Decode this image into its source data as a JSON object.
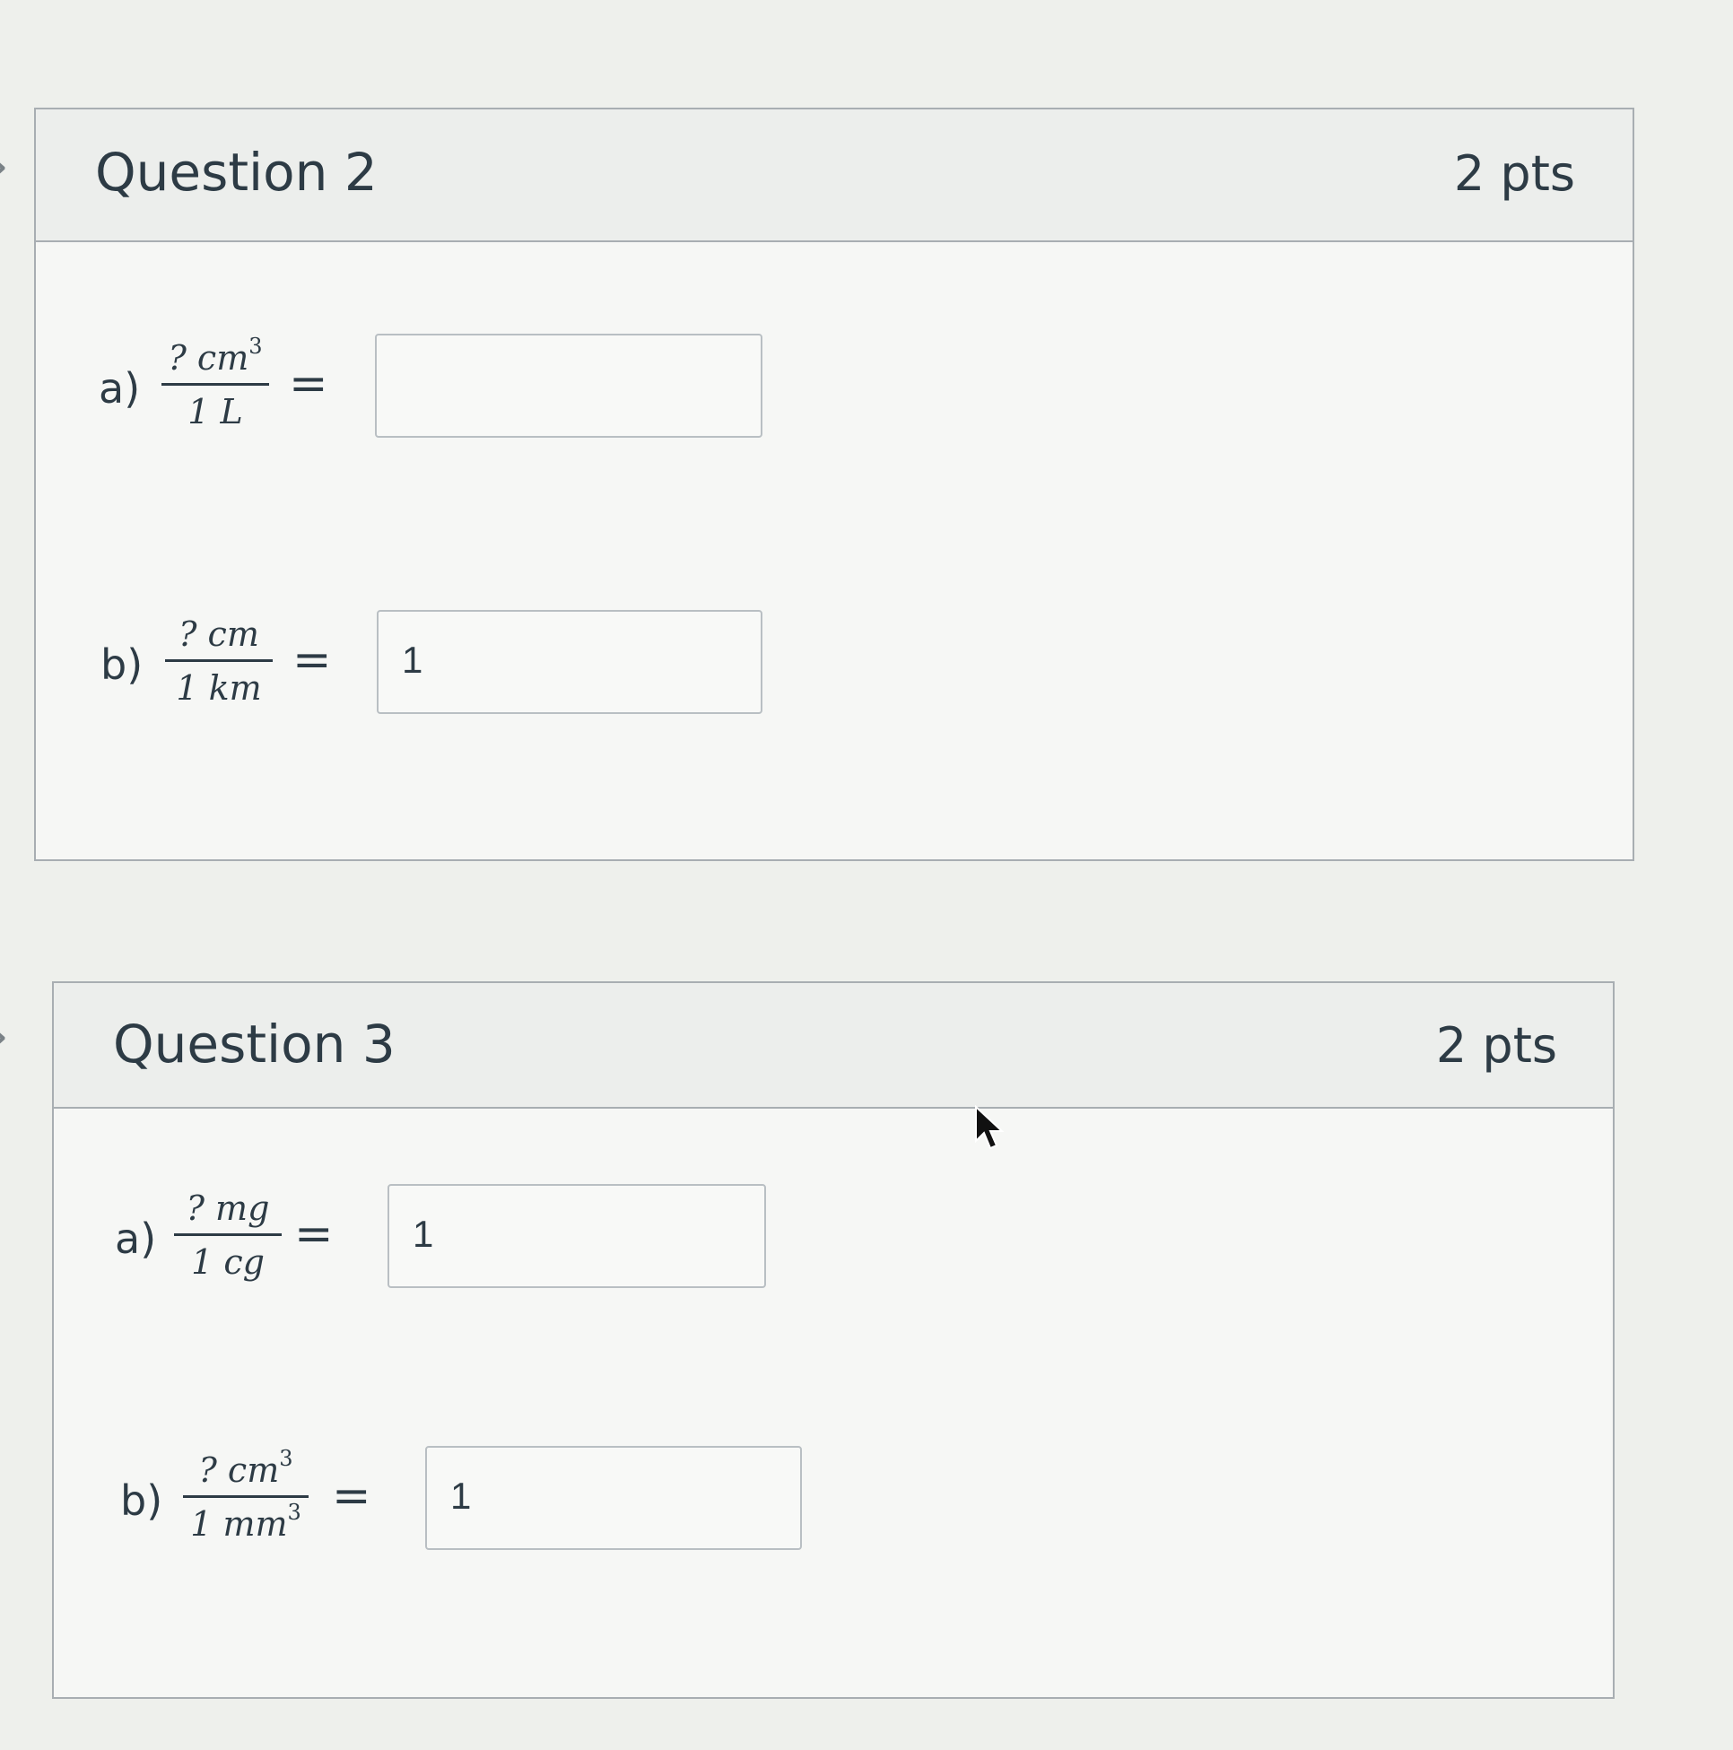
{
  "questions": [
    {
      "title": "Question 2",
      "points": "2 pts",
      "parts": [
        {
          "label": "a)",
          "numerator": "? cm",
          "numerator_sup": "3",
          "denominator": "1 L",
          "denominator_sup": "",
          "equals": "=",
          "answer": ""
        },
        {
          "label": "b)",
          "numerator": "? cm",
          "numerator_sup": "",
          "denominator": "1 km",
          "denominator_sup": "",
          "equals": "=",
          "answer": "1"
        }
      ]
    },
    {
      "title": "Question 3",
      "points": "2 pts",
      "parts": [
        {
          "label": "a)",
          "numerator": "? mg",
          "numerator_sup": "",
          "denominator": "1 cg",
          "denominator_sup": "",
          "equals": "=",
          "answer": "1"
        },
        {
          "label": "b)",
          "numerator": "? cm",
          "numerator_sup": "3",
          "denominator": "1 mm",
          "denominator_sup": "3",
          "equals": "=",
          "answer": "1"
        }
      ]
    }
  ],
  "icons": {
    "expand": "chevron-right-icon",
    "pointer": "mouse-cursor-icon"
  },
  "colors": {
    "text": "#2d3b45",
    "border": "#a8aeb2",
    "header_bg": "#eceeec",
    "body_bg": "#f6f7f5"
  }
}
